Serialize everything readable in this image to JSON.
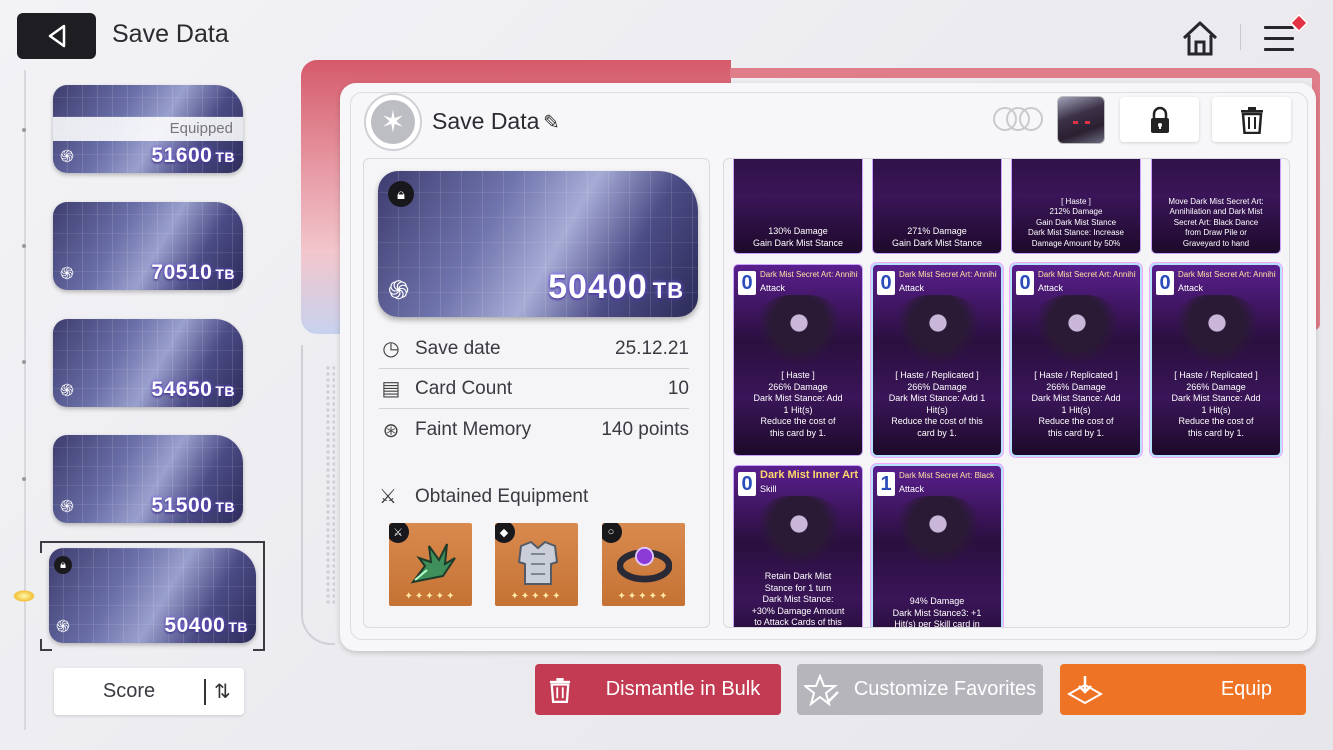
{
  "header": {
    "title": "Save Data",
    "back_icon": "back-arrow-icon",
    "home_icon": "home-icon",
    "menu_icon": "menu-icon"
  },
  "save_list": [
    {
      "score": "51600",
      "unit": "TB",
      "status": "Equipped",
      "locked": false
    },
    {
      "score": "70510",
      "unit": "TB",
      "status": "",
      "locked": false
    },
    {
      "score": "54650",
      "unit": "TB",
      "status": "",
      "locked": false
    },
    {
      "score": "51500",
      "unit": "TB",
      "status": "",
      "locked": false
    },
    {
      "score": "50400",
      "unit": "TB",
      "status": "",
      "locked": true,
      "selected": true
    }
  ],
  "sort": {
    "label": "Score"
  },
  "detail": {
    "title": "Save Data",
    "score": "50400",
    "unit": "TB",
    "rows": [
      {
        "key": "Save date",
        "value": "25.12.21",
        "icon": "clock-icon"
      },
      {
        "key": "Card Count",
        "value": "10",
        "icon": "cards-icon"
      },
      {
        "key": "Faint Memory",
        "value": "140 points",
        "icon": "brain-icon"
      }
    ],
    "equipment_label": "Obtained Equipment",
    "equipment": [
      {
        "name": "weapon",
        "icon": "claw-weapon-icon",
        "stars": "✦✦✦✦✦"
      },
      {
        "name": "armor",
        "icon": "armor-icon",
        "stars": "✦✦✦✦✦"
      },
      {
        "name": "accessory",
        "icon": "ring-icon",
        "stars": "✦✦✦✦✦"
      }
    ]
  },
  "cards": [
    {
      "cost": "",
      "name": "",
      "type": "",
      "desc": "130% Damage\nGain Dark Mist Stance"
    },
    {
      "cost": "",
      "name": "",
      "type": "",
      "desc": "271% Damage\nGain Dark Mist Stance"
    },
    {
      "cost": "",
      "name": "",
      "type": "",
      "desc": "[ Haste ]\n212% Damage\nGain Dark Mist Stance\nDark Mist Stance: Increase\nDamage Amount by 50%"
    },
    {
      "cost": "",
      "name": "",
      "type": "",
      "desc": "Move Dark Mist Secret Art:\nAnnihilation and Dark Mist\nSecret Art: Black Dance\nfrom Draw Pile or\nGraveyard to hand"
    },
    {
      "cost": "0",
      "name": "Dark Mist Secret Art: Annihilation",
      "type": "Attack",
      "desc": "[ Haste ]\n266% Damage\nDark Mist Stance: Add\n1 Hit(s)\nReduce the cost of\nthis card by 1."
    },
    {
      "cost": "0",
      "name": "Dark Mist Secret Art: Annihilation",
      "type": "Attack",
      "desc": "[ Haste / Replicated ]\n266% Damage\nDark Mist Stance: Add 1\nHit(s)\nReduce the cost of this\ncard by 1."
    },
    {
      "cost": "0",
      "name": "Dark Mist Secret Art: Annihilation",
      "type": "Attack",
      "desc": "[ Haste / Replicated ]\n266% Damage\nDark Mist Stance: Add\n1 Hit(s)\nReduce the cost of\nthis card by 1."
    },
    {
      "cost": "0",
      "name": "Dark Mist Secret Art: Annihilation",
      "type": "Attack",
      "desc": "[ Haste / Replicated ]\n266% Damage\nDark Mist Stance: Add\n1 Hit(s)\nReduce the cost of\nthis card by 1."
    },
    {
      "cost": "0",
      "name": "Dark Mist Inner Art",
      "type": "Skill",
      "desc": "Retain Dark Mist\nStance for 1 turn\nDark Mist Stance:\n+30% Damage Amount\nto Attack Cards of this"
    },
    {
      "cost": "1",
      "name": "Dark Mist Secret Art: Black Dance",
      "type": "Attack",
      "desc": "94% Damage\nDark Mist Stance3: +1\nHit(s) per Skill card in"
    }
  ],
  "actions": {
    "dismantle": "Dismantle in Bulk",
    "customize": "Customize Favorites",
    "equip": "Equip"
  },
  "colors": {
    "dismantle": "#c33b52",
    "customize": "#b5b5bb",
    "equip": "#ef7325",
    "accent_pink": "#e07d8a"
  }
}
